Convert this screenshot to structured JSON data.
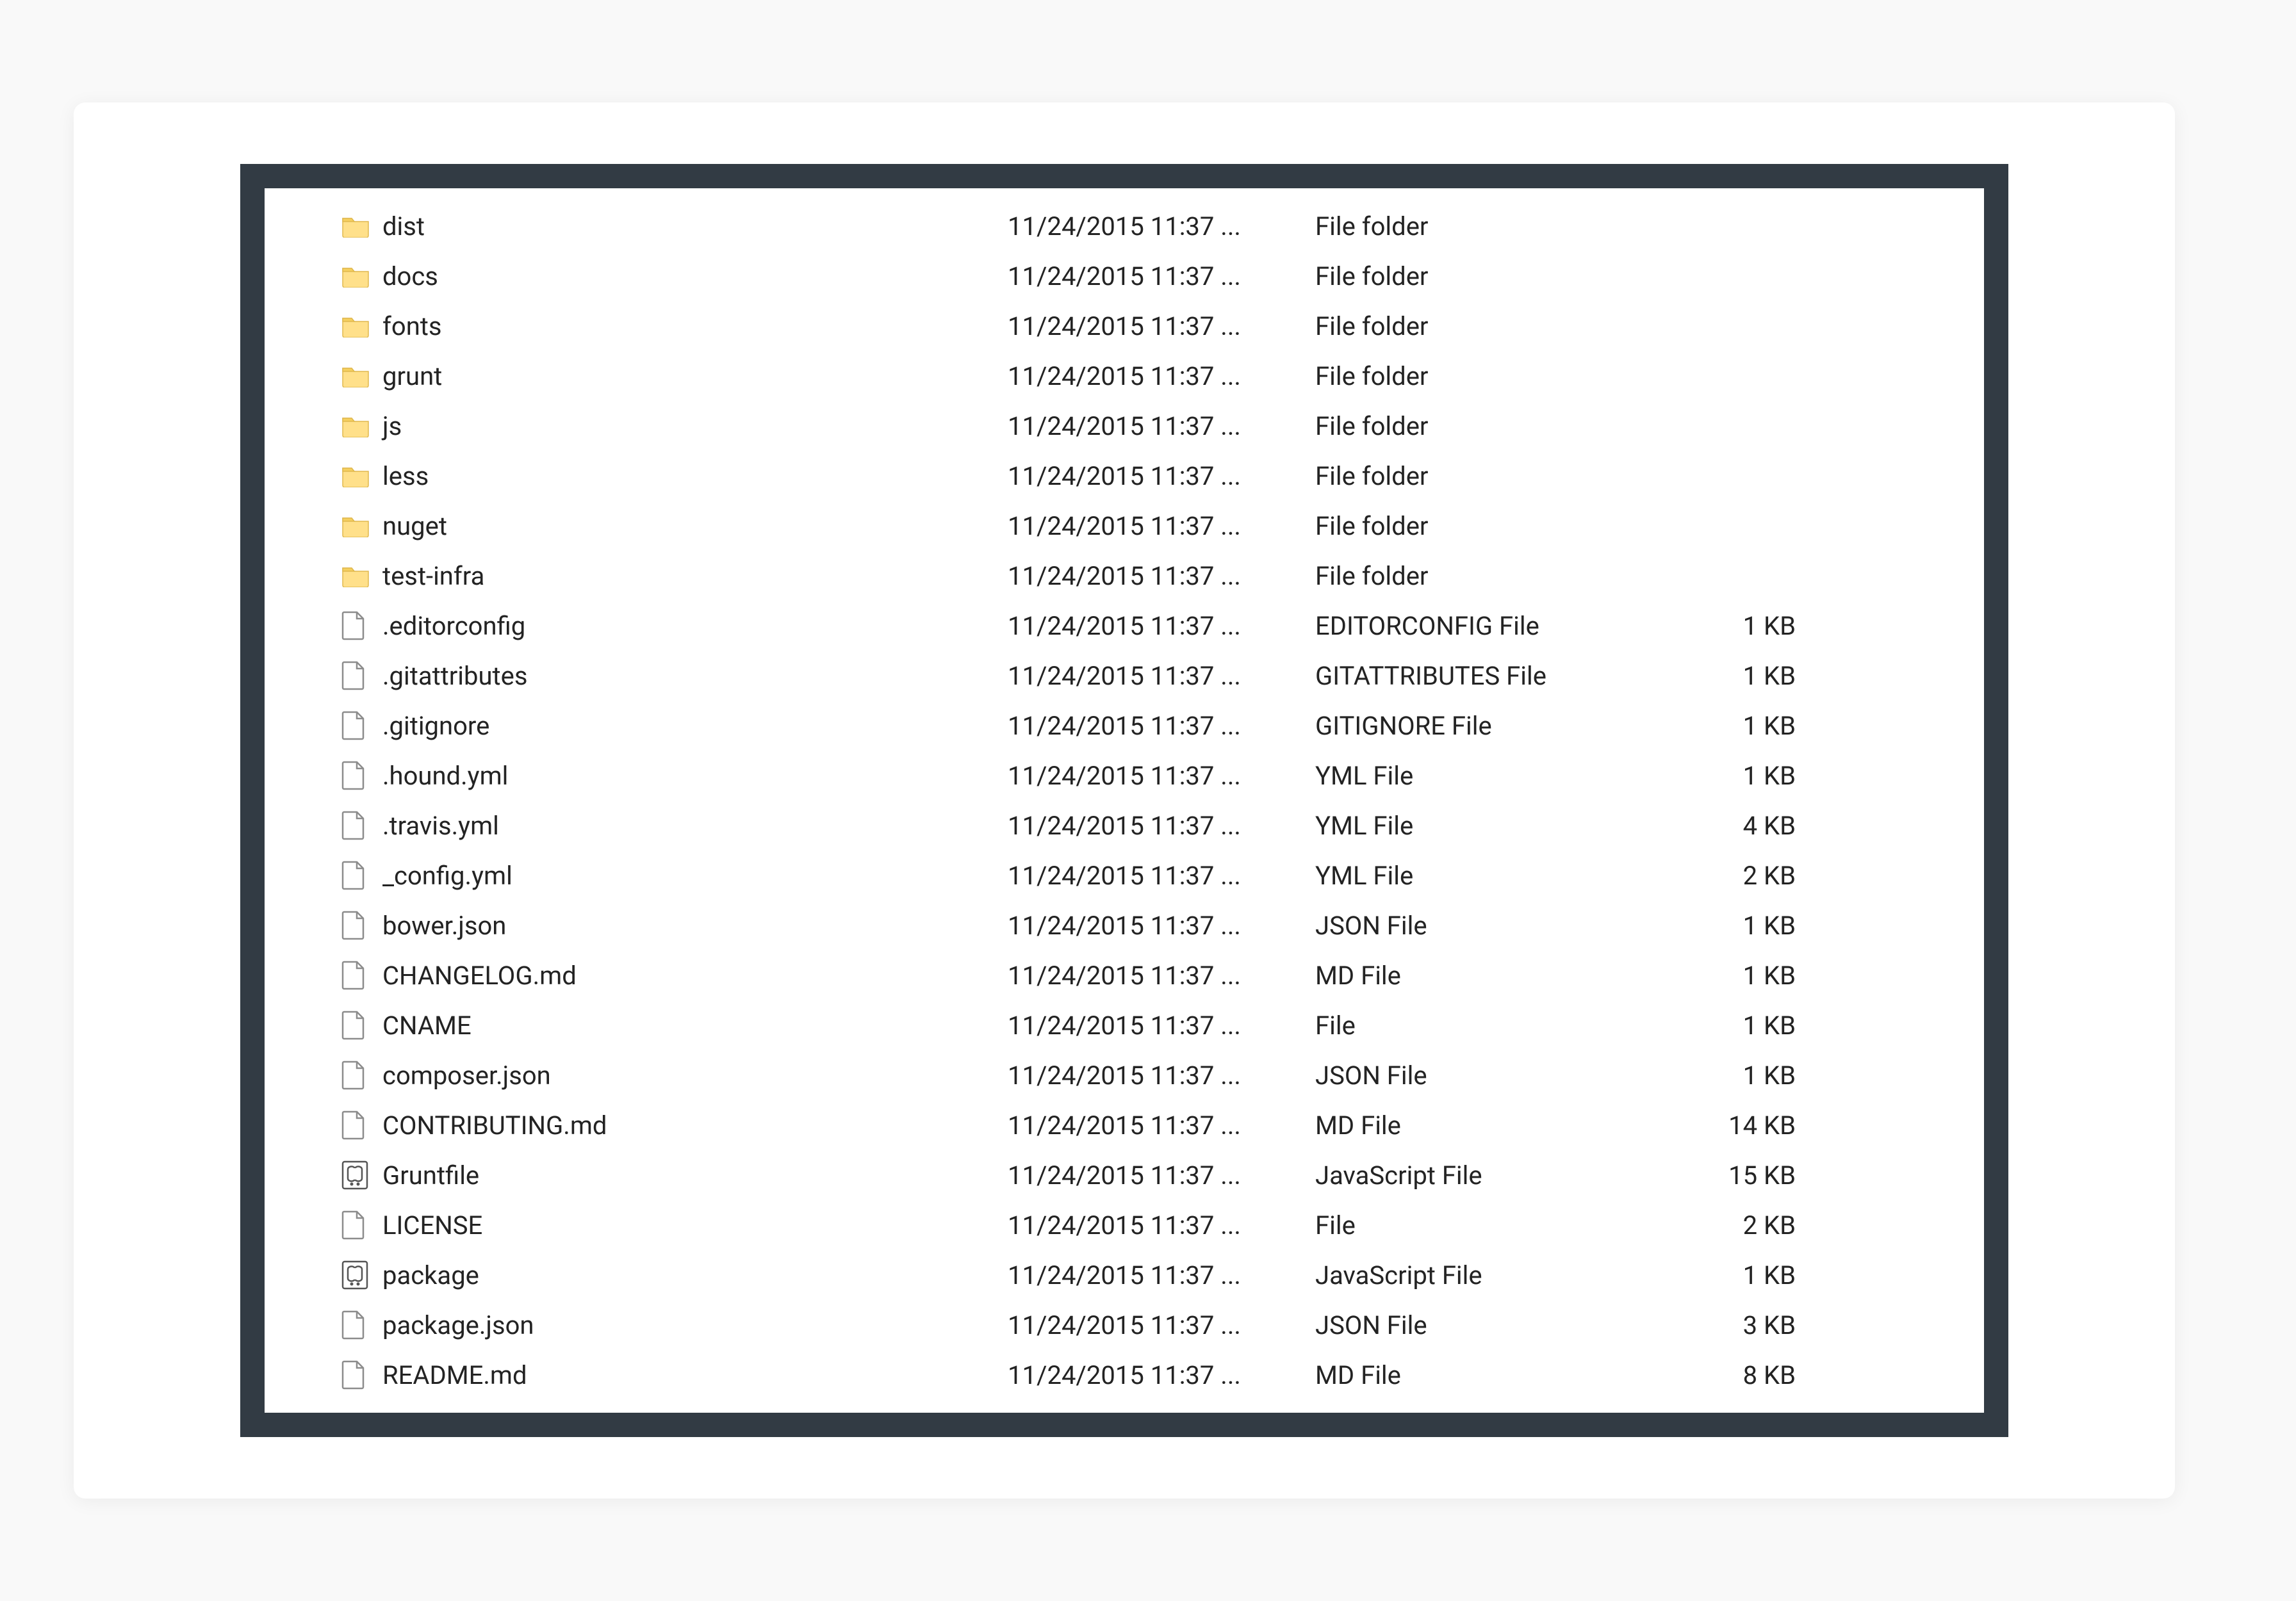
{
  "files": [
    {
      "icon": "folder",
      "name": "dist",
      "date": "11/24/2015 11:37 ...",
      "type": "File folder",
      "size": ""
    },
    {
      "icon": "folder",
      "name": "docs",
      "date": "11/24/2015 11:37 ...",
      "type": "File folder",
      "size": ""
    },
    {
      "icon": "folder",
      "name": "fonts",
      "date": "11/24/2015 11:37 ...",
      "type": "File folder",
      "size": ""
    },
    {
      "icon": "folder",
      "name": "grunt",
      "date": "11/24/2015 11:37 ...",
      "type": "File folder",
      "size": ""
    },
    {
      "icon": "folder",
      "name": "js",
      "date": "11/24/2015 11:37 ...",
      "type": "File folder",
      "size": ""
    },
    {
      "icon": "folder",
      "name": "less",
      "date": "11/24/2015 11:37 ...",
      "type": "File folder",
      "size": ""
    },
    {
      "icon": "folder",
      "name": "nuget",
      "date": "11/24/2015 11:37 ...",
      "type": "File folder",
      "size": ""
    },
    {
      "icon": "folder",
      "name": "test-infra",
      "date": "11/24/2015 11:37 ...",
      "type": "File folder",
      "size": ""
    },
    {
      "icon": "file",
      "name": ".editorconfig",
      "date": "11/24/2015 11:37 ...",
      "type": "EDITORCONFIG File",
      "size": "1 KB"
    },
    {
      "icon": "file",
      "name": ".gitattributes",
      "date": "11/24/2015 11:37 ...",
      "type": "GITATTRIBUTES File",
      "size": "1 KB"
    },
    {
      "icon": "file",
      "name": ".gitignore",
      "date": "11/24/2015 11:37 ...",
      "type": "GITIGNORE File",
      "size": "1 KB"
    },
    {
      "icon": "file",
      "name": ".hound.yml",
      "date": "11/24/2015 11:37 ...",
      "type": "YML File",
      "size": "1 KB"
    },
    {
      "icon": "file",
      "name": ".travis.yml",
      "date": "11/24/2015 11:37 ...",
      "type": "YML File",
      "size": "4 KB"
    },
    {
      "icon": "file",
      "name": "_config.yml",
      "date": "11/24/2015 11:37 ...",
      "type": "YML File",
      "size": "2 KB"
    },
    {
      "icon": "file",
      "name": "bower.json",
      "date": "11/24/2015 11:37 ...",
      "type": "JSON File",
      "size": "1 KB"
    },
    {
      "icon": "file",
      "name": "CHANGELOG.md",
      "date": "11/24/2015 11:37 ...",
      "type": "MD File",
      "size": "1 KB"
    },
    {
      "icon": "file",
      "name": "CNAME",
      "date": "11/24/2015 11:37 ...",
      "type": "File",
      "size": "1 KB"
    },
    {
      "icon": "file",
      "name": "composer.json",
      "date": "11/24/2015 11:37 ...",
      "type": "JSON File",
      "size": "1 KB"
    },
    {
      "icon": "file",
      "name": "CONTRIBUTING.md",
      "date": "11/24/2015 11:37 ...",
      "type": "MD File",
      "size": "14 KB"
    },
    {
      "icon": "js",
      "name": "Gruntfile",
      "date": "11/24/2015 11:37 ...",
      "type": "JavaScript File",
      "size": "15 KB"
    },
    {
      "icon": "file",
      "name": "LICENSE",
      "date": "11/24/2015 11:37 ...",
      "type": "File",
      "size": "2 KB"
    },
    {
      "icon": "js",
      "name": "package",
      "date": "11/24/2015 11:37 ...",
      "type": "JavaScript File",
      "size": "1 KB"
    },
    {
      "icon": "file",
      "name": "package.json",
      "date": "11/24/2015 11:37 ...",
      "type": "JSON File",
      "size": "3 KB"
    },
    {
      "icon": "file",
      "name": "README.md",
      "date": "11/24/2015 11:37 ...",
      "type": "MD File",
      "size": "8 KB"
    }
  ]
}
